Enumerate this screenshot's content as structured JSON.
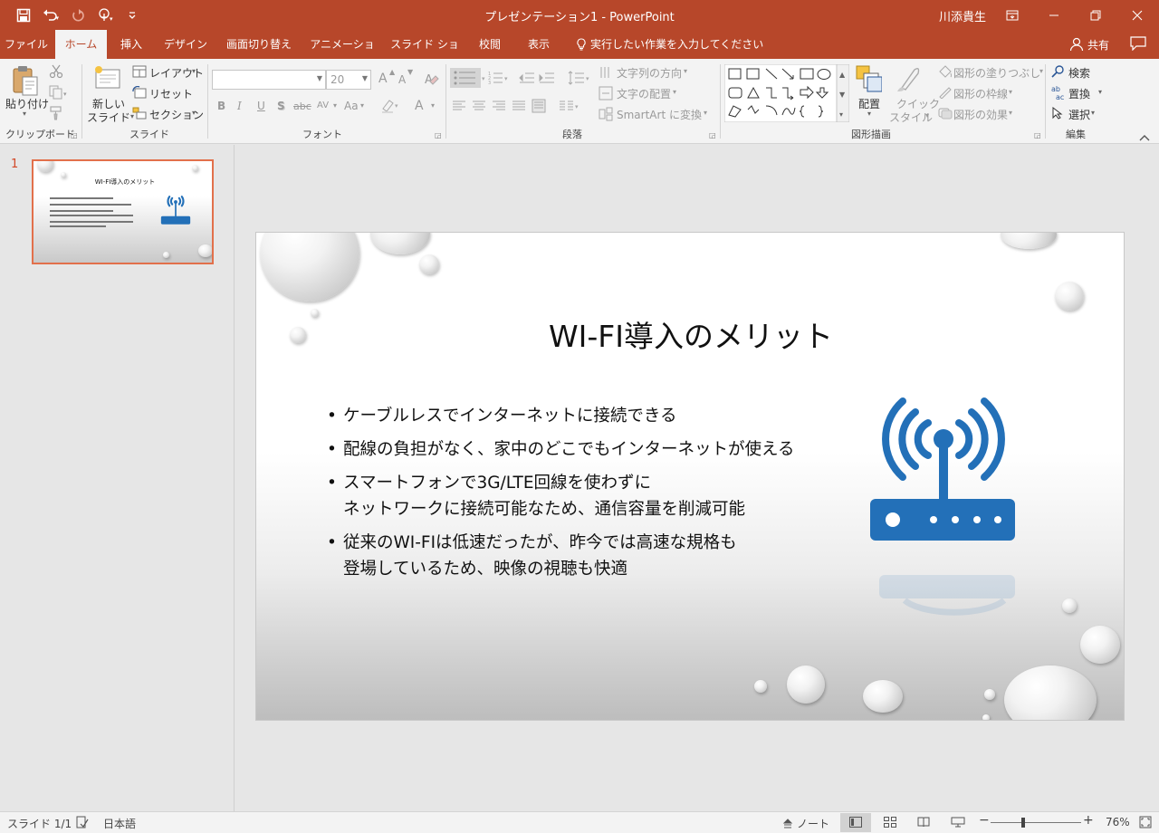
{
  "app": {
    "title": "プレゼンテーション1  -  PowerPoint",
    "user": "川添貴生",
    "accent": "#b7472a"
  },
  "qat": {
    "icons": [
      "save-icon",
      "undo-icon",
      "redo-icon",
      "touch-mode-icon",
      "customize-qat-icon"
    ]
  },
  "tabs": [
    {
      "label": "ファイル"
    },
    {
      "label": "ホーム"
    },
    {
      "label": "挿入"
    },
    {
      "label": "デザイン"
    },
    {
      "label": "画面切り替え"
    },
    {
      "label": "アニメーション"
    },
    {
      "label": "スライド ショー"
    },
    {
      "label": "校閲"
    },
    {
      "label": "表示"
    }
  ],
  "tellme": "実行したい作業を入力してください",
  "share": "共有",
  "ribbon": {
    "clipboard": {
      "paste": "貼り付け",
      "label": "クリップボード"
    },
    "slides": {
      "new_slide_1": "新しい",
      "new_slide_2": "スライド",
      "layout": "レイアウト",
      "reset": "リセット",
      "section": "セクション",
      "label": "スライド"
    },
    "font": {
      "font_name": "",
      "font_size": "20",
      "label": "フォント",
      "bold": "B",
      "italic": "I",
      "underline": "U",
      "shadow": "S",
      "strike": "abc",
      "spacing": "AV",
      "case": "Aa",
      "color": "A",
      "grow": "A",
      "shrink": "A"
    },
    "paragraph": {
      "text_direction": "文字列の方向",
      "align_text": "文字の配置",
      "smartart": "SmartArt に変換",
      "label": "段落"
    },
    "drawing": {
      "arrange": "配置",
      "quick_styles_1": "クイック",
      "quick_styles_2": "スタイル",
      "fill": "図形の塗りつぶし",
      "outline": "図形の枠線",
      "effects": "図形の効果",
      "label": "図形描画"
    },
    "editing": {
      "find": "検索",
      "replace": "置換",
      "select": "選択",
      "label": "編集"
    }
  },
  "thumbnail": {
    "number": "1"
  },
  "slide": {
    "title": "WI-FI導入のメリット",
    "bullets": [
      [
        "ケーブルレスでインターネットに接続できる"
      ],
      [
        "配線の負担がなく、家中のどこでもインターネットが使える"
      ],
      [
        "スマートフォンで3G/LTE回線を使わずに",
        "ネットワークに接続可能なため、通信容量を削減可能"
      ],
      [
        "従来のWI-FIは低速だったが、昨今では高速な規格も",
        "登場しているため、映像の視聴も快適"
      ]
    ],
    "icon": "wifi-router-icon",
    "icon_color": "#2370b8"
  },
  "status": {
    "slide_count": "スライド 1/1",
    "language": "日本語",
    "notes": "ノート",
    "zoom": "76%"
  }
}
